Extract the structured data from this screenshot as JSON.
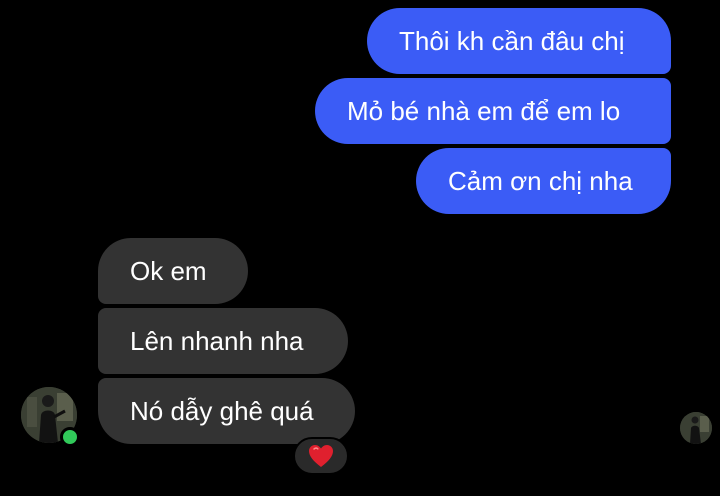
{
  "conversation": {
    "sent": [
      {
        "text": "Thôi kh cần đâu chị"
      },
      {
        "text": "Mỏ bé nhà em để em lo"
      },
      {
        "text": "Cảm ơn chị nha"
      }
    ],
    "received": [
      {
        "text": "Ok em"
      },
      {
        "text": "Lên nhanh nha"
      },
      {
        "text": "Nó dẫy ghê quá"
      }
    ],
    "reaction": {
      "icon": "heart-icon",
      "color": "#e0202e"
    }
  },
  "colors": {
    "sent_bubble": "#3b5cf6",
    "received_bubble": "#333333",
    "online": "#31c95a",
    "background": "#000000"
  }
}
